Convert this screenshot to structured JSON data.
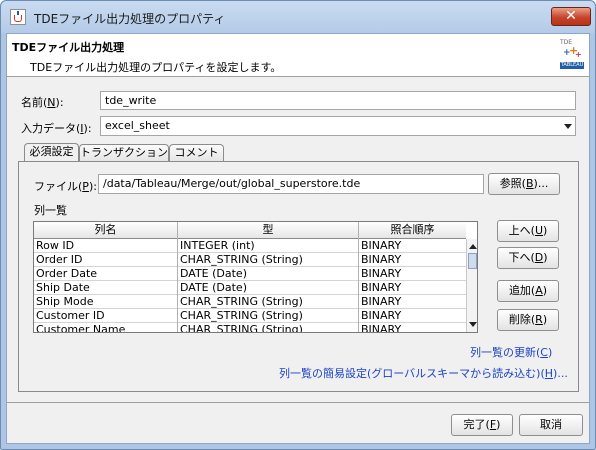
{
  "window": {
    "title": "TDEファイル出力処理のプロパティ",
    "close_label": "✕"
  },
  "header": {
    "title": "TDEファイル出力処理",
    "description": "TDEファイル出力処理のプロパティを設定します。",
    "icon_text": "TDE",
    "icon_band": "TABLEAU"
  },
  "name_field": {
    "label": "名前(",
    "mnemonic": "N",
    "label_end": "):",
    "value": "tde_write"
  },
  "input_data": {
    "label": "入力データ(",
    "mnemonic": "I",
    "label_end": "):",
    "value": "excel_sheet"
  },
  "tabs": [
    {
      "label": "必須設定"
    },
    {
      "label": "トランザクション"
    },
    {
      "label": "コメント"
    }
  ],
  "file_field": {
    "label": "ファイル(",
    "mnemonic": "P",
    "label_end": "):",
    "value": "/data/Tableau/Merge/out/global_superstore.tde",
    "browse_label": "参照(",
    "browse_mnemonic": "B",
    "browse_end": ")..."
  },
  "column_list": {
    "label": "列一覧",
    "headers": [
      "列名",
      "型",
      "照合順序"
    ],
    "rows": [
      [
        "Row ID",
        "INTEGER (int)",
        "BINARY"
      ],
      [
        "Order ID",
        "CHAR_STRING (String)",
        "BINARY"
      ],
      [
        "Order Date",
        "DATE (Date)",
        "BINARY"
      ],
      [
        "Ship Date",
        "DATE (Date)",
        "BINARY"
      ],
      [
        "Ship Mode",
        "CHAR_STRING (String)",
        "BINARY"
      ],
      [
        "Customer ID",
        "CHAR_STRING (String)",
        "BINARY"
      ],
      [
        "Customer Name",
        "CHAR_STRING (String)",
        "BINARY"
      ]
    ]
  },
  "side_buttons": {
    "up": {
      "label": "上へ(",
      "mnemonic": "U",
      "end": ")"
    },
    "down": {
      "label": "下へ(",
      "mnemonic": "D",
      "end": ")"
    },
    "add": {
      "label": "追加(",
      "mnemonic": "A",
      "end": ")"
    },
    "delete": {
      "label": "削除(",
      "mnemonic": "R",
      "end": ")"
    }
  },
  "links": {
    "refresh": {
      "label": "列一覧の更新(",
      "mnemonic": "C",
      "end": ")"
    },
    "simple_setup": {
      "label": "列一覧の簡易設定(グローバルスキーマから読み込む)(",
      "mnemonic": "H",
      "end": ")..."
    }
  },
  "footer": {
    "ok": {
      "label": "完了(",
      "mnemonic": "F",
      "end": ")"
    },
    "cancel": {
      "label": "取消"
    }
  }
}
